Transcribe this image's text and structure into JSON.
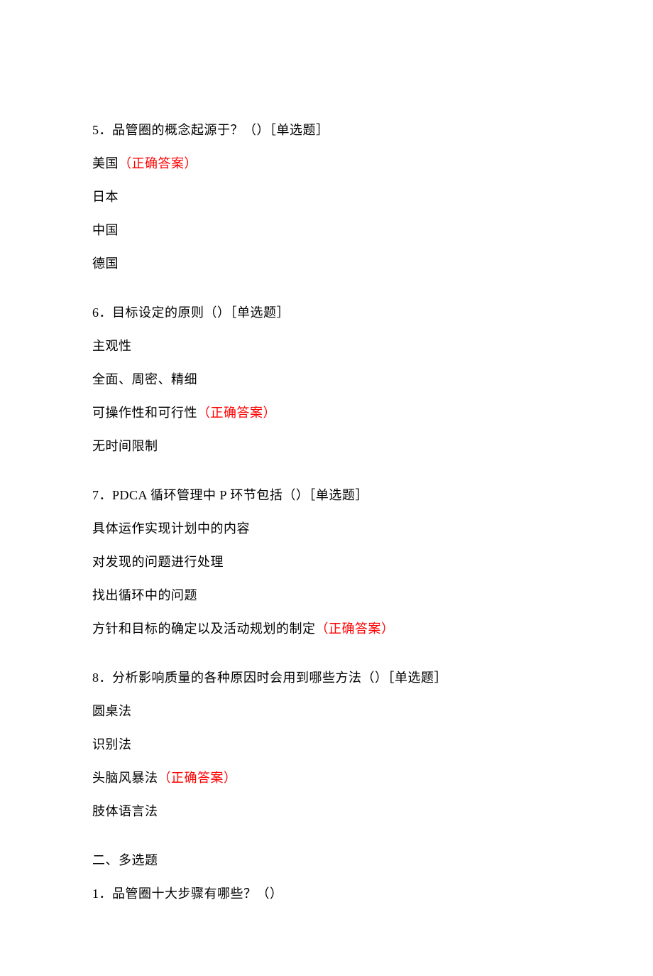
{
  "questions": [
    {
      "number": "5",
      "text": "．品管圈的概念起源于？（）［单选题］",
      "options": [
        {
          "text": "美国",
          "correct": true
        },
        {
          "text": "日本",
          "correct": false
        },
        {
          "text": "中国",
          "correct": false
        },
        {
          "text": "德国",
          "correct": false
        }
      ]
    },
    {
      "number": "6",
      "text": "．目标设定的原则（）［单选题］",
      "options": [
        {
          "text": "主观性",
          "correct": false
        },
        {
          "text": "全面、周密、精细",
          "correct": false
        },
        {
          "text": "可操作性和可行性",
          "correct": true
        },
        {
          "text": "无时间限制",
          "correct": false
        }
      ]
    },
    {
      "number": "7",
      "text": "．PDCA 循环管理中 P 环节包括（）［单选题］",
      "options": [
        {
          "text": "具体运作实现计划中的内容",
          "correct": false
        },
        {
          "text": "对发现的问题进行处理",
          "correct": false
        },
        {
          "text": "找出循环中的问题",
          "correct": false
        },
        {
          "text": "方针和目标的确定以及活动规划的制定",
          "correct": true
        }
      ]
    },
    {
      "number": "8",
      "text": "．分析影响质量的各种原因时会用到哪些方法（）［单选题］",
      "options": [
        {
          "text": "圆桌法",
          "correct": false
        },
        {
          "text": "识别法",
          "correct": false
        },
        {
          "text": "头脑风暴法",
          "correct": true
        },
        {
          "text": "肢体语言法",
          "correct": false
        }
      ]
    }
  ],
  "section2": {
    "title": "二、多选题",
    "q1": {
      "number": "1",
      "text": "．品管圈十大步骤有哪些？（）"
    }
  },
  "correctAnswerLabel": "（正确答案）"
}
